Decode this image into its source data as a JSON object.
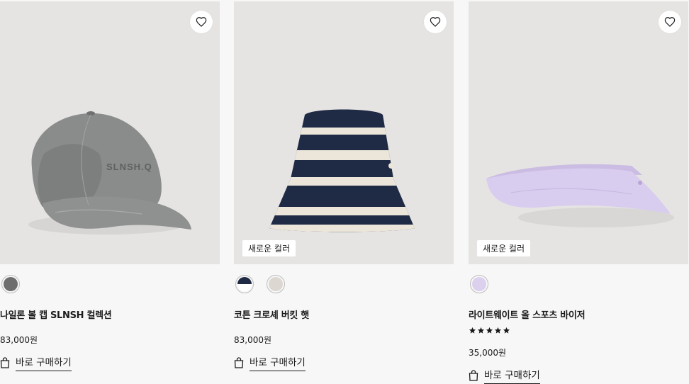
{
  "products": [
    {
      "name": "나일론 볼 캡 SLNSH 컬렉션",
      "price": "83,000원",
      "badge": "",
      "swatches": [
        "#6e6e6e"
      ],
      "print_text": "SLNSH.Q",
      "buy_label": "바로 구매하기"
    },
    {
      "name": "코튼 크로셰 버킷 햇",
      "price": "83,000원",
      "badge": "새로운 컬러",
      "swatches": [
        "#1f2a44|#ffffff",
        "#dcd7d1"
      ],
      "buy_label": "바로 구매하기"
    },
    {
      "name": "라이트웨이트 올 스포츠 바이저",
      "price": "35,000원",
      "badge": "새로운 컬러",
      "rating": 5,
      "swatches": [
        "#dcd0ef"
      ],
      "buy_label": "바로 구매하기"
    }
  ],
  "icons": {
    "favorite": "heart-icon",
    "buy": "shopping-bag-icon"
  },
  "colors": {
    "image_bg": "#e5e4e2",
    "page_bg": "#f7f7f7"
  }
}
